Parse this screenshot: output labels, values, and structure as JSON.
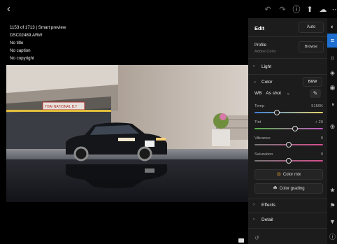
{
  "header": {
    "back_icon": "chevron-left-icon",
    "tools": [
      "undo-icon",
      "redo-icon",
      "info-icon",
      "share-icon",
      "cloud-icon",
      "more-icon"
    ]
  },
  "photo_info": {
    "line1": "1153 of 1713 | Smart preview",
    "line2": "DSC02489.ARW",
    "line3": "No title",
    "line4": "No caption",
    "line5": "No copyright"
  },
  "scene": {
    "sign_text": "THAI NATIONAL B.T"
  },
  "panel": {
    "title": "Edit",
    "auto_label": "Auto",
    "profile_label": "Profile",
    "profile_value": "Adobe Color",
    "browse_label": "Browse",
    "light_label": "Light",
    "color_label": "Color",
    "bw_label": "B&W",
    "wb_label": "WB",
    "wb_value": "As shot",
    "sliders": {
      "temp": {
        "label": "Temp",
        "value": "5150K",
        "pos": 0.33
      },
      "tint": {
        "label": "Tint",
        "value": "+ 20",
        "pos": 0.59
      },
      "vibrance": {
        "label": "Vibrance",
        "value": "0",
        "pos": 0.5
      },
      "saturation": {
        "label": "Saturation",
        "value": "0",
        "pos": 0.5
      }
    },
    "color_mix_label": "Color mix",
    "color_grading_label": "Color grading",
    "effects_label": "Effects",
    "detail_label": "Detail"
  },
  "colors": {
    "accent": "#1d6fd1",
    "panel_bg": "#1c1c1c"
  }
}
